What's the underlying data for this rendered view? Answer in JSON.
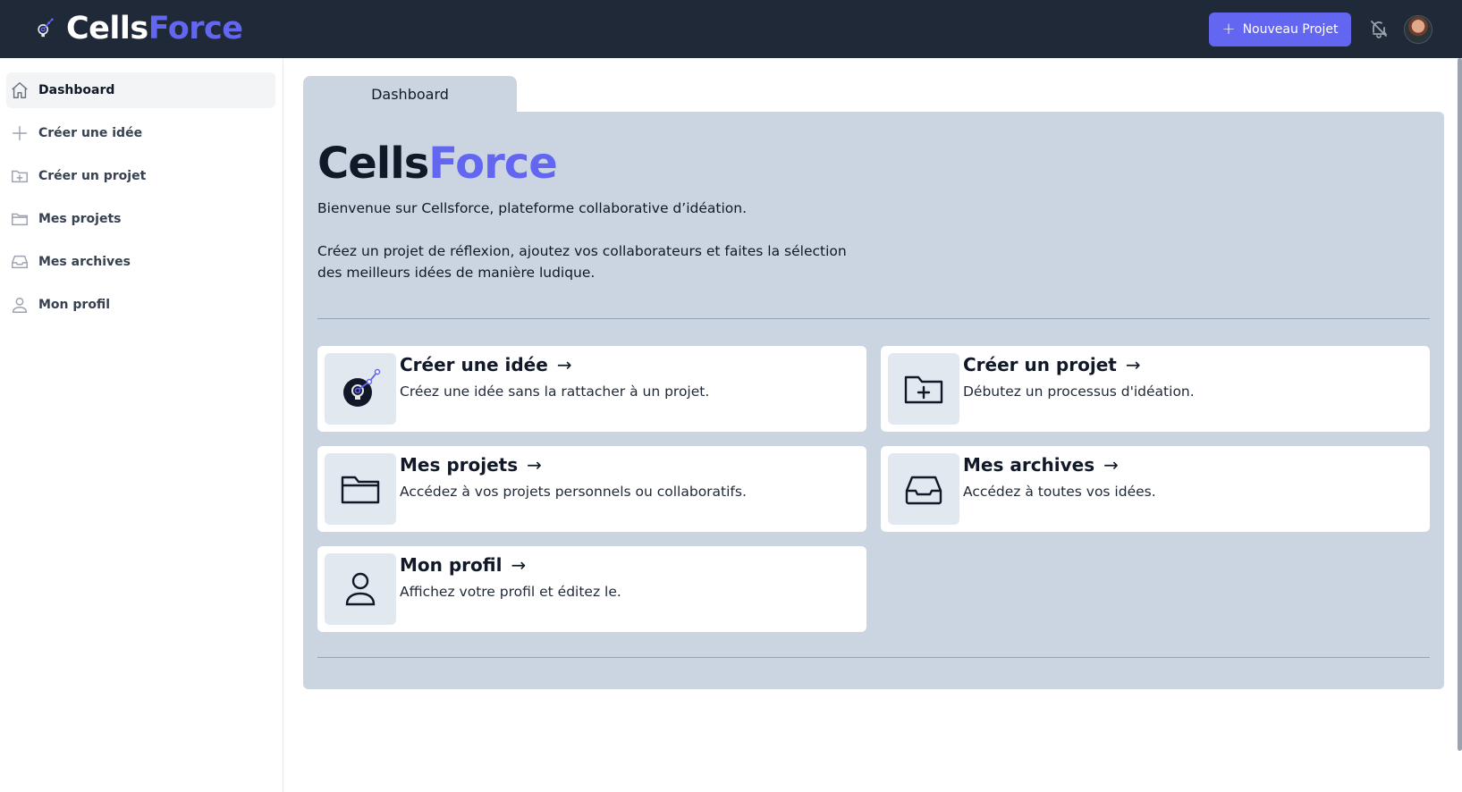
{
  "header": {
    "brand_part1": "Cells",
    "brand_part2": "Force",
    "new_project_label": "Nouveau Projet",
    "accent_color": "#6366f1",
    "bg_color": "#1f2937"
  },
  "sidebar": {
    "items": [
      {
        "label": "Dashboard",
        "icon": "home-icon",
        "active": true
      },
      {
        "label": "Créer une idée",
        "icon": "plus-icon"
      },
      {
        "label": "Créer un projet",
        "icon": "folder-plus-icon"
      },
      {
        "label": "Mes projets",
        "icon": "folder-icon"
      },
      {
        "label": "Mes archives",
        "icon": "inbox-icon"
      },
      {
        "label": "Mon profil",
        "icon": "user-icon"
      }
    ]
  },
  "main": {
    "tab_label": "Dashboard",
    "title_part1": "Cells",
    "title_part2": "Force",
    "intro_1": "Bienvenue sur Cellsforce, plateforme collaborative d’idéation.",
    "intro_2": "Créez un projet de réflexion, ajoutez vos collaborateurs et faites la sélection des meilleurs idées de manière ludique.",
    "cards": [
      {
        "title": "Créer une idée",
        "desc": "Créez une idée sans la rattacher à un projet.",
        "icon": "lightbulb-icon"
      },
      {
        "title": "Créer un projet",
        "desc": "Débutez un processus d'idéation.",
        "icon": "folder-plus-icon"
      },
      {
        "title": "Mes projets",
        "desc": "Accédez à vos projets personnels ou collaboratifs.",
        "icon": "folder-icon"
      },
      {
        "title": "Mes archives",
        "desc": "Accédez à toutes vos idées.",
        "icon": "inbox-icon"
      },
      {
        "title": "Mon profil",
        "desc": "Affichez votre profil et éditez le.",
        "icon": "user-icon"
      }
    ],
    "arrow": "→"
  }
}
